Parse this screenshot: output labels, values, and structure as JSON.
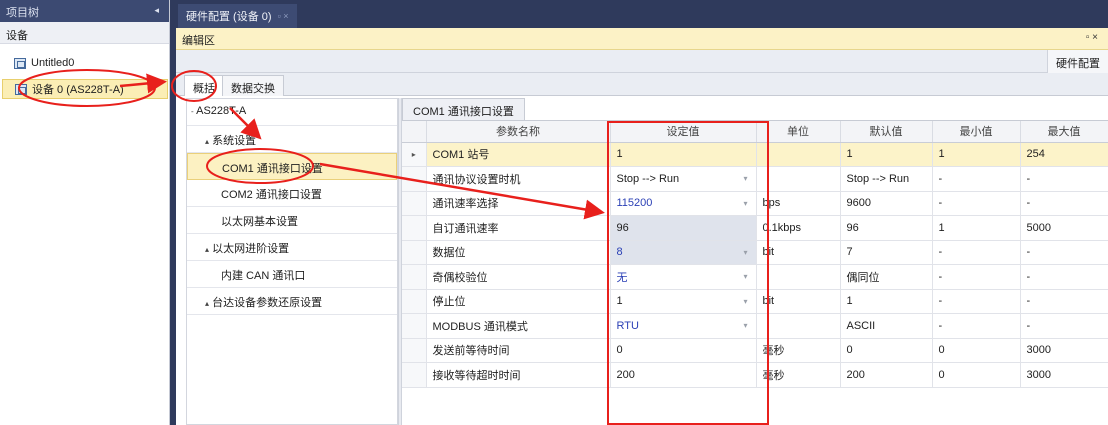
{
  "left_panel": {
    "title": "项目树",
    "pin_glyph": "◂",
    "section_label": "设备",
    "items": [
      {
        "label": "Untitled0"
      },
      {
        "label": "设备 0 (AS228T-A)"
      }
    ]
  },
  "main_tab": {
    "label": "硬件配置 (设备 0)",
    "icons": "▫ ×"
  },
  "edit_area": {
    "label": "编辑区",
    "close_glyph": "▫ ×"
  },
  "hw_tab": "硬件配置",
  "subtabs": [
    "概括",
    "数据交换"
  ],
  "config_tree": [
    {
      "label": "AS228T-A",
      "expander": "-"
    },
    {
      "label": "系统设置",
      "expander": "▴"
    },
    {
      "label": "COM1 通讯接口设置"
    },
    {
      "label": "COM2 通讯接口设置"
    },
    {
      "label": "以太网基本设置"
    },
    {
      "label": "以太网进阶设置",
      "expander": "▴"
    },
    {
      "label": "内建 CAN 通讯口"
    },
    {
      "label": "台达设备参数还原设置",
      "expander": "▴"
    }
  ],
  "grid_tab": "COM1 通讯接口设置",
  "grid": {
    "headers": [
      "参数名称",
      "设定值",
      "单位",
      "默认值",
      "最小值",
      "最大值"
    ],
    "rows": [
      {
        "name": "COM1 站号",
        "value": "1",
        "unit": "",
        "default": "1",
        "min": "1",
        "max": "254",
        "selected": true
      },
      {
        "name": "通讯协议设置时机",
        "value": "Stop --> Run",
        "unit": "",
        "default": "Stop --> Run",
        "min": "-",
        "max": "-",
        "dropdown": true
      },
      {
        "name": "通讯速率选择",
        "value": "115200",
        "unit": "bps",
        "default": "9600",
        "min": "-",
        "max": "-",
        "dropdown": true,
        "blue": true
      },
      {
        "name": "自订通讯速率",
        "value": "96",
        "unit": "0.1kbps",
        "default": "96",
        "min": "1",
        "max": "5000",
        "hl": true
      },
      {
        "name": "数据位",
        "value": "8",
        "unit": "bit",
        "default": "7",
        "min": "-",
        "max": "-",
        "dropdown": true,
        "blue": true,
        "hl": true
      },
      {
        "name": "奇偶校验位",
        "value": "无",
        "unit": "",
        "default": "偶同位",
        "min": "-",
        "max": "-",
        "dropdown": true,
        "blue": true
      },
      {
        "name": "停止位",
        "value": "1",
        "unit": "bit",
        "default": "1",
        "min": "-",
        "max": "-",
        "dropdown": true
      },
      {
        "name": "MODBUS 通讯模式",
        "value": "RTU",
        "unit": "",
        "default": "ASCII",
        "min": "-",
        "max": "-",
        "dropdown": true,
        "blue": true
      },
      {
        "name": "发送前等待时间",
        "value": "0",
        "unit": "毫秒",
        "default": "0",
        "min": "0",
        "max": "3000"
      },
      {
        "name": "接收等待超时时间",
        "value": "200",
        "unit": "毫秒",
        "default": "200",
        "min": "0",
        "max": "3000"
      }
    ]
  },
  "row_selector_glyph": "▸",
  "dropdown_glyph": "▾",
  "colors": {
    "annotation": "#e8201c",
    "title_bar": "#2f3a5c",
    "selected": "#fcf1c2"
  }
}
